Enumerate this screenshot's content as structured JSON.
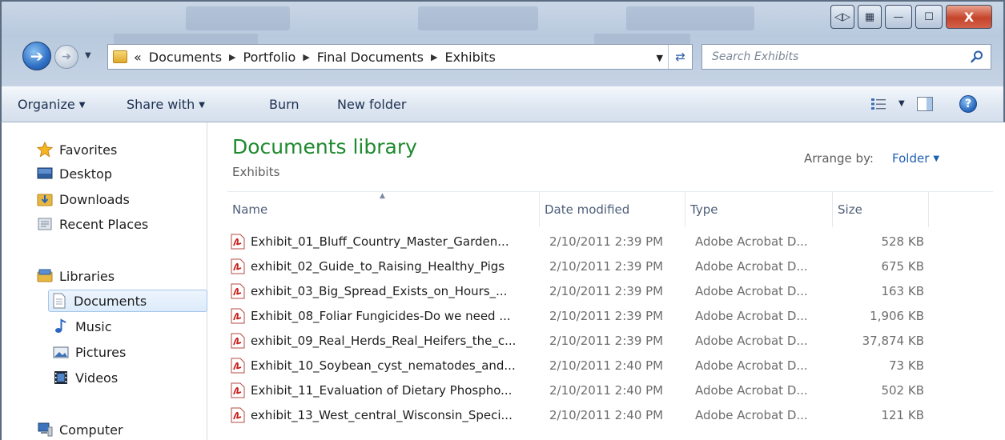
{
  "window": {
    "controls": {
      "minimize": "—",
      "maximize": "☐",
      "close": "X"
    }
  },
  "address": {
    "overflow": "«",
    "crumbs": [
      "Documents",
      "Portfolio",
      "Final Documents",
      "Exhibits"
    ],
    "search_placeholder": "Search Exhibits"
  },
  "toolbar": {
    "organize": "Organize",
    "share_with": "Share with",
    "burn": "Burn",
    "new_folder": "New folder"
  },
  "nav": {
    "favorites": "Favorites",
    "desktop": "Desktop",
    "downloads": "Downloads",
    "recent_places": "Recent Places",
    "libraries": "Libraries",
    "documents": "Documents",
    "music": "Music",
    "pictures": "Pictures",
    "videos": "Videos",
    "computer": "Computer"
  },
  "library": {
    "title": "Documents library",
    "subtitle": "Exhibits",
    "arrange_label": "Arrange by:",
    "arrange_value": "Folder"
  },
  "columns": {
    "name": "Name",
    "date": "Date modified",
    "type": "Type",
    "size": "Size"
  },
  "files": [
    {
      "name": "Exhibit_01_Bluff_Country_Master_Garden...",
      "date": "2/10/2011 2:39 PM",
      "type": "Adobe Acrobat D...",
      "size": "528 KB"
    },
    {
      "name": "exhibit_02_Guide_to_Raising_Healthy_Pigs",
      "date": "2/10/2011 2:39 PM",
      "type": "Adobe Acrobat D...",
      "size": "675 KB"
    },
    {
      "name": "exhibit_03_Big_Spread_Exists_on_Hours_...",
      "date": "2/10/2011 2:39 PM",
      "type": "Adobe Acrobat D...",
      "size": "163 KB"
    },
    {
      "name": "Exhibit_08_Foliar Fungicides-Do we need ...",
      "date": "2/10/2011 2:39 PM",
      "type": "Adobe Acrobat D...",
      "size": "1,906 KB"
    },
    {
      "name": "exhibit_09_Real_Herds_Real_Heifers_the_c...",
      "date": "2/10/2011 2:39 PM",
      "type": "Adobe Acrobat D...",
      "size": "37,874 KB"
    },
    {
      "name": "Exhibit_10_Soybean_cyst_nematodes_and...",
      "date": "2/10/2011 2:40 PM",
      "type": "Adobe Acrobat D...",
      "size": "73 KB"
    },
    {
      "name": "Exhibit_11_Evaluation of Dietary Phospho...",
      "date": "2/10/2011 2:40 PM",
      "type": "Adobe Acrobat D...",
      "size": "502 KB"
    },
    {
      "name": "exhibit_13_West_central_Wisconsin_Speci...",
      "date": "2/10/2011 2:40 PM",
      "type": "Adobe Acrobat D...",
      "size": "121 KB"
    }
  ],
  "colors": {
    "library_title": "#1e8a2e",
    "link_blue": "#1f5fb3",
    "pdf_red": "#c8201c"
  }
}
